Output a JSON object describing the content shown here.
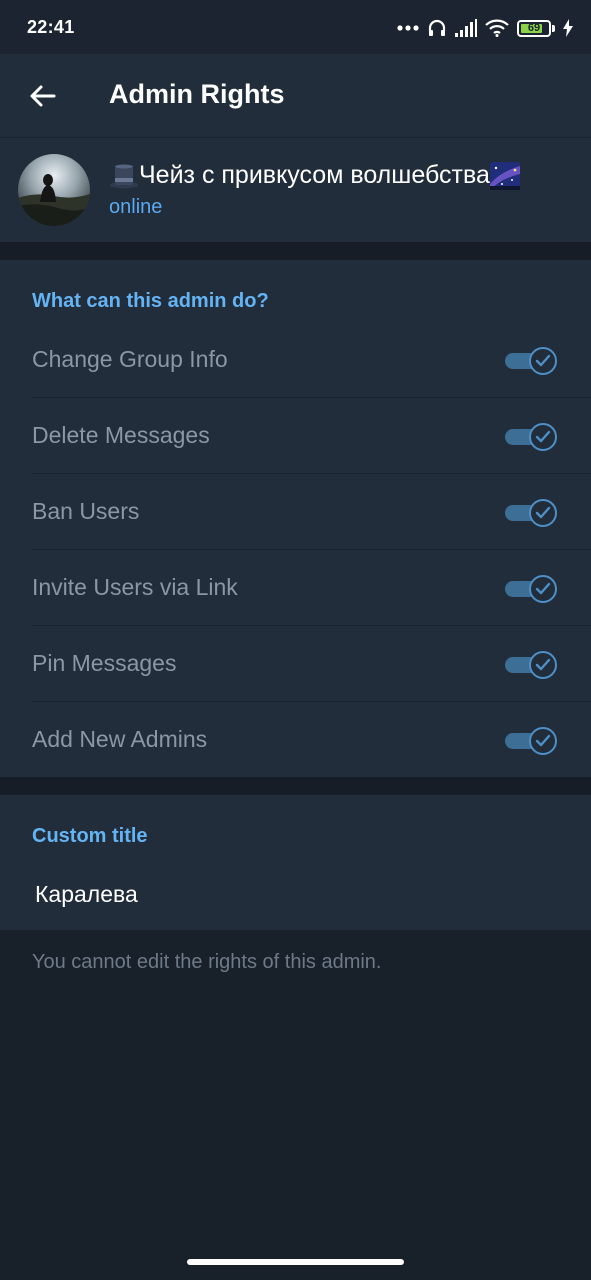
{
  "status_bar": {
    "time": "22:41",
    "battery_level": "69",
    "icons": [
      "more-dots-icon",
      "headphones-icon",
      "signal-icon",
      "wifi-icon",
      "battery-icon",
      "charging-icon"
    ]
  },
  "header": {
    "title": "Admin Rights",
    "back_icon": "arrow-left-icon"
  },
  "profile": {
    "name": "Чейз с привкусом волшебства",
    "status": "online",
    "name_prefix_icon": "top-hat-emoji",
    "name_suffix_icon": "milky-way-emoji"
  },
  "rights": {
    "header": "What can this admin do?",
    "items": [
      {
        "label": "Change Group Info",
        "enabled": true
      },
      {
        "label": "Delete Messages",
        "enabled": true
      },
      {
        "label": "Ban Users",
        "enabled": true
      },
      {
        "label": "Invite Users via Link",
        "enabled": true
      },
      {
        "label": "Pin Messages",
        "enabled": true
      },
      {
        "label": "Add New Admins",
        "enabled": true
      }
    ]
  },
  "custom_title": {
    "header": "Custom title",
    "value": "Каралева"
  },
  "note": "You cannot edit the rights of this admin.",
  "colors": {
    "background": "#18202a",
    "panel": "#212d3b",
    "accent": "#64b4f4",
    "toggle_track": "#3d6e96"
  }
}
